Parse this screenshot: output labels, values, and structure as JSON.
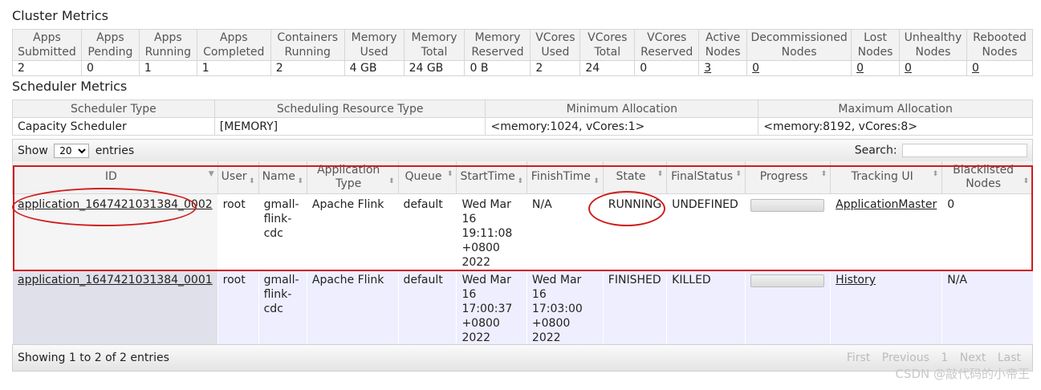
{
  "cluster_metrics": {
    "title": "Cluster Metrics",
    "headers": [
      "Apps Submitted",
      "Apps Pending",
      "Apps Running",
      "Apps Completed",
      "Containers Running",
      "Memory Used",
      "Memory Total",
      "Memory Reserved",
      "VCores Used",
      "VCores Total",
      "VCores Reserved",
      "Active Nodes",
      "Decommissioned Nodes",
      "Lost Nodes",
      "Unhealthy Nodes",
      "Rebooted Nodes"
    ],
    "values": [
      "2",
      "0",
      "1",
      "1",
      "2",
      "4 GB",
      "24 GB",
      "0 B",
      "2",
      "24",
      "0",
      "3",
      "0",
      "0",
      "0",
      "0"
    ]
  },
  "scheduler_metrics": {
    "title": "Scheduler Metrics",
    "headers": [
      "Scheduler Type",
      "Scheduling Resource Type",
      "Minimum Allocation",
      "Maximum Allocation"
    ],
    "values": [
      "Capacity Scheduler",
      "[MEMORY]",
      "<memory:1024, vCores:1>",
      "<memory:8192, vCores:8>"
    ]
  },
  "toolbar": {
    "show_label": "Show",
    "entries_label": "entries",
    "page_size": "20",
    "search_label": "Search:",
    "search_value": ""
  },
  "apps_table": {
    "headers": [
      "ID",
      "User",
      "Name",
      "Application Type",
      "Queue",
      "StartTime",
      "FinishTime",
      "State",
      "FinalStatus",
      "Progress",
      "Tracking UI",
      "Blacklisted Nodes"
    ],
    "rows": [
      {
        "id": "application_1647421031384_0002",
        "user": "root",
        "name": "gmall-flink-cdc",
        "type": "Apache Flink",
        "queue": "default",
        "start": "Wed Mar 16 19:11:08 +0800 2022",
        "finish": "N/A",
        "state": "RUNNING",
        "final_status": "UNDEFINED",
        "progress": 0,
        "tracking_ui": "ApplicationMaster",
        "blacklisted": "0"
      },
      {
        "id": "application_1647421031384_0001",
        "user": "root",
        "name": "gmall-flink-cdc",
        "type": "Apache Flink",
        "queue": "default",
        "start": "Wed Mar 16 17:00:37 +0800 2022",
        "finish": "Wed Mar 16 17:03:00 +0800 2022",
        "state": "FINISHED",
        "final_status": "KILLED",
        "progress": 0,
        "tracking_ui": "History",
        "blacklisted": "N/A"
      }
    ]
  },
  "footer": {
    "info": "Showing 1 to 2 of 2 entries",
    "first": "First",
    "previous": "Previous",
    "page": "1",
    "next": "Next",
    "last": "Last"
  },
  "watermark": "CSDN @敲代码的小帝王",
  "annotation_color": "#d01c1c"
}
